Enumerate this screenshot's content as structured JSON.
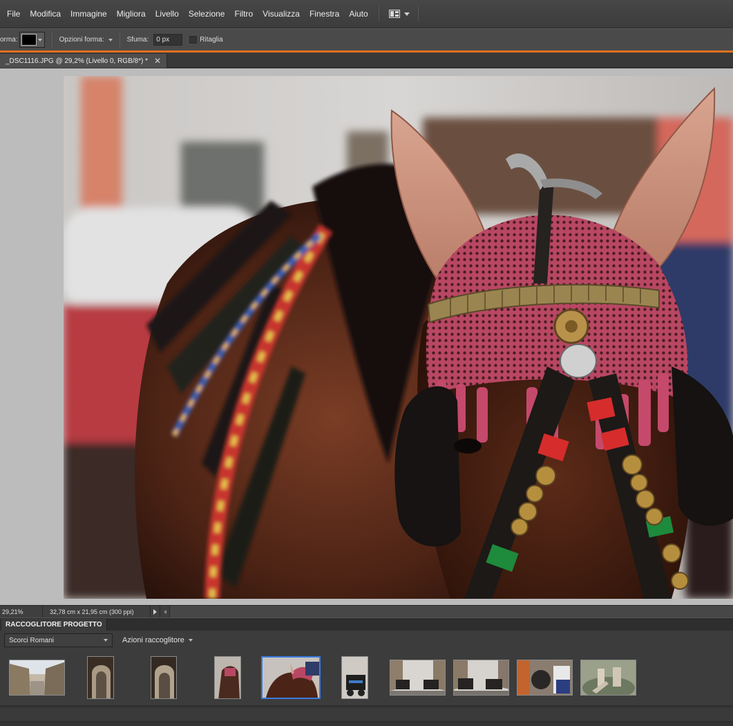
{
  "menubar": {
    "items": [
      "File",
      "Modifica",
      "Immagine",
      "Migliora",
      "Livello",
      "Selezione",
      "Filtro",
      "Visualizza",
      "Finestra",
      "Aiuto"
    ],
    "workspace_icon": "panel-layout-icon"
  },
  "options": {
    "shape_label": "orma:",
    "shape_options_label": "Opzioni forma:",
    "feather_label": "Sfuma:",
    "feather_value": "0 px",
    "crop_label": "Ritaglia",
    "crop_checked": false,
    "accent_color": "#e0701f"
  },
  "document": {
    "tab_title": "_DSC1116.JPG @ 29,2% (Livello 0, RGB/8*) *"
  },
  "status": {
    "zoom": "29,21%",
    "doc_size": "32,78 cm x 21,95 cm (300 ppi)"
  },
  "project_bin": {
    "title": "RACCOGLITORE PROGETTO",
    "album_select": "Scorci Romani",
    "actions_label": "Azioni raccoglitore",
    "thumbnail_count": 10,
    "selected_index": 4,
    "selection_color": "#3b7be0"
  }
}
